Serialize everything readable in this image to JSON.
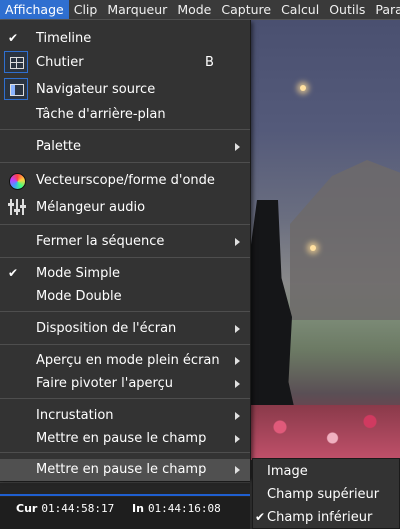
{
  "menubar": {
    "items": [
      "Affichage",
      "Clip",
      "Marqueur",
      "Mode",
      "Capture",
      "Calcul",
      "Outils",
      "Paramè"
    ]
  },
  "menu": {
    "timeline": "Timeline",
    "chutier": "Chutier",
    "chutier_shortcut": "B",
    "navigateur": "Navigateur source",
    "tache": "Tâche d'arrière-plan",
    "palette": "Palette",
    "vectorscope": "Vecteurscope/forme d'onde",
    "melangeur": "Mélangeur audio",
    "fermer": "Fermer la séquence",
    "mode_simple": "Mode Simple",
    "mode_double": "Mode Double",
    "disposition": "Disposition de l'écran",
    "apercu_plein": "Aperçu en mode plein écran",
    "pivoter": "Faire pivoter l'aperçu",
    "incrustation": "Incrustation",
    "pause1": "Mettre en pause le champ",
    "pause2": "Mettre en pause le champ"
  },
  "submenu": {
    "items": [
      "Image",
      "Champ supérieur",
      "Champ inférieur"
    ],
    "checked_index": 2
  },
  "timecodes": {
    "cur_label": "Cur",
    "cur_value": "01:44:58:17",
    "in_label": "In",
    "in_value": "01:44:16:08"
  },
  "icons": {
    "check": "checkmark-icon",
    "chutier": "bin-grid-icon",
    "navigateur": "source-window-icon",
    "vectorscope": "vectorscope-icon",
    "melangeur": "audio-mixer-icon",
    "submenu_arrow": "chevron-right-icon"
  },
  "colors": {
    "accent": "#2f6fd0",
    "menu_bg": "#333333",
    "highlight": "#505050"
  }
}
